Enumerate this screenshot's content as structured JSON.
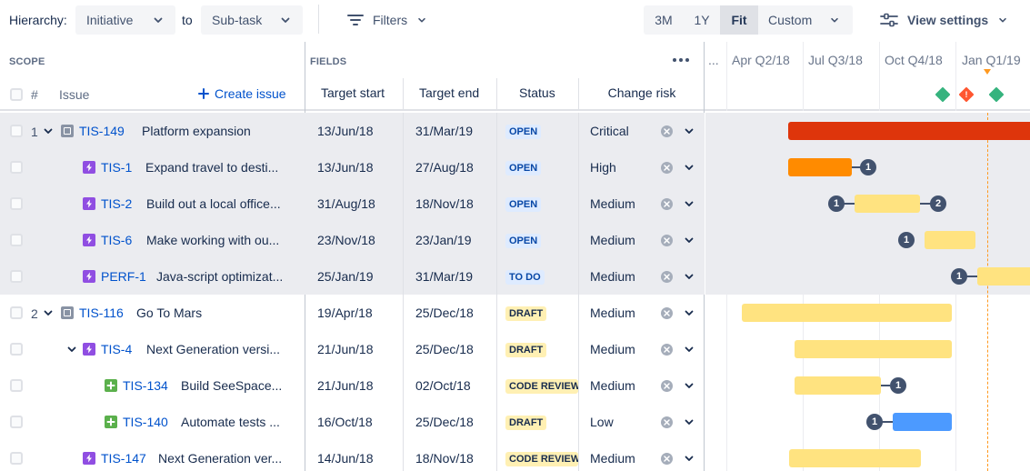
{
  "toolbar": {
    "hierarchy_label": "Hierarchy:",
    "hierarchy_from": "Initiative",
    "to_label": "to",
    "hierarchy_to": "Sub-task",
    "filters_label": "Filters",
    "zoom": [
      "3M",
      "1Y",
      "Fit",
      "Custom"
    ],
    "zoom_active": "Fit",
    "view_settings_label": "View settings"
  },
  "header": {
    "scope_label": "SCOPE",
    "fields_label": "FIELDS",
    "num_col": "#",
    "issue_col": "Issue",
    "create_issue": "Create issue",
    "columns": [
      "Target start",
      "Target end",
      "Status",
      "Change risk"
    ],
    "timeline_ellipsis": "...",
    "quarters": [
      "Apr Q2/18",
      "Jul Q3/18",
      "Oct Q4/18",
      "Jan Q1/19"
    ]
  },
  "rows": [
    {
      "num": "1",
      "key": "TIS-149",
      "summary": "Platform expansion",
      "type": "initiative",
      "start": "13/Jun/18",
      "end": "31/Mar/19",
      "status": "OPEN",
      "risk": "Critical"
    },
    {
      "num": "",
      "key": "TIS-1",
      "summary": "Expand travel to desti...",
      "type": "epic",
      "start": "13/Jun/18",
      "end": "27/Aug/18",
      "status": "OPEN",
      "risk": "High"
    },
    {
      "num": "",
      "key": "TIS-2",
      "summary": "Build out a local office...",
      "type": "epic",
      "start": "31/Aug/18",
      "end": "18/Nov/18",
      "status": "OPEN",
      "risk": "Medium"
    },
    {
      "num": "",
      "key": "TIS-6",
      "summary": "Make working with ou...",
      "type": "epic",
      "start": "23/Nov/18",
      "end": "23/Jan/19",
      "status": "OPEN",
      "risk": "Medium"
    },
    {
      "num": "",
      "key": "PERF-1",
      "summary": "Java-script optimizat...",
      "type": "epic",
      "start": "25/Jan/19",
      "end": "31/Mar/19",
      "status": "TO DO",
      "risk": "Medium"
    },
    {
      "num": "2",
      "key": "TIS-116",
      "summary": "Go To Mars",
      "type": "initiative",
      "start": "19/Apr/18",
      "end": "25/Dec/18",
      "status": "DRAFT",
      "risk": "Medium"
    },
    {
      "num": "",
      "key": "TIS-4",
      "summary": "Next Generation versi...",
      "type": "epic",
      "start": "21/Jun/18",
      "end": "25/Dec/18",
      "status": "DRAFT",
      "risk": "Medium"
    },
    {
      "num": "",
      "key": "TIS-134",
      "summary": "Build SeeSpace...",
      "type": "subtask",
      "start": "21/Jun/18",
      "end": "02/Oct/18",
      "status": "CODE REVIEW",
      "risk": "Medium"
    },
    {
      "num": "",
      "key": "TIS-140",
      "summary": "Automate tests ...",
      "type": "subtask",
      "start": "16/Oct/18",
      "end": "25/Dec/18",
      "status": "DRAFT",
      "risk": "Low"
    },
    {
      "num": "",
      "key": "TIS-147",
      "summary": "Next Generation ver...",
      "type": "epic",
      "start": "14/Jun/18",
      "end": "18/Nov/18",
      "status": "CODE REVIEW",
      "risk": "Medium"
    }
  ],
  "badges": [
    "1",
    "1",
    "2",
    "1",
    "1",
    "1",
    "1"
  ],
  "colors": {
    "critical": "#de350b",
    "high": "#ff8b00",
    "medium": "#ffe380",
    "low": "#4c9aff",
    "milestone_green": "#36b37e",
    "milestone_red": "#ff5630",
    "today": "#ff991f"
  },
  "milestone_warning": "!"
}
